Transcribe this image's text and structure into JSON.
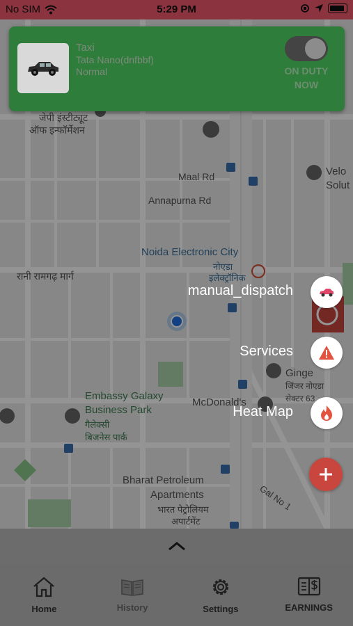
{
  "status_bar": {
    "carrier": "No SIM",
    "time": "5:29 PM"
  },
  "duty_card": {
    "vehicle_type": "Taxi",
    "vehicle_name": "Tata Nano(dnfbbf)",
    "vehicle_class": "Normal",
    "duty_status_line1": "ON DUTY",
    "duty_status_line2": "NOW",
    "toggle_on": true,
    "card_color": "#2f7d3a"
  },
  "map": {
    "labels": [
      {
        "text": "जेपी इंस्टीट्यूट",
        "style": "normal"
      },
      {
        "text": "ऑफ इन्फॉर्मेशन",
        "style": "normal"
      },
      {
        "text": "Maal Rd",
        "style": "normal"
      },
      {
        "text": "Annapurna Rd",
        "style": "normal"
      },
      {
        "text": "Noida Electronic City",
        "style": "blue"
      },
      {
        "text": "नोएडा",
        "style": "blue"
      },
      {
        "text": "इलेक्ट्रॉनिक",
        "style": "blue"
      },
      {
        "text": "रानी रामगढ़ मार्ग",
        "style": "normal"
      },
      {
        "text": "Embassy Galaxy",
        "style": "green"
      },
      {
        "text": "Business Park",
        "style": "green"
      },
      {
        "text": "गैलेक्सी",
        "style": "green"
      },
      {
        "text": "बिजनेस पार्क",
        "style": "green"
      },
      {
        "text": "McDonald's",
        "style": "normal"
      },
      {
        "text": "Bharat Petroleum",
        "style": "normal"
      },
      {
        "text": "Apartments",
        "style": "normal"
      },
      {
        "text": "भारत पेट्रोलियम",
        "style": "normal"
      },
      {
        "text": "अपार्टमेंट",
        "style": "normal"
      },
      {
        "text": "Gal No 1",
        "style": "normal"
      },
      {
        "text": "Velo",
        "style": "normal"
      },
      {
        "text": "Solut",
        "style": "normal"
      },
      {
        "text": "Ginge",
        "style": "normal"
      },
      {
        "text": "जिंजर नोएडा",
        "style": "normal"
      },
      {
        "text": "सेक्टर 63",
        "style": "normal"
      }
    ]
  },
  "fab_menu": {
    "manual_dispatch": "manual_dispatch",
    "services": "Services",
    "heat_map": "Heat Map"
  },
  "tabs": [
    {
      "label": "Home",
      "icon": "home-icon"
    },
    {
      "label": "History",
      "icon": "book-icon"
    },
    {
      "label": "Settings",
      "icon": "gear-icon"
    },
    {
      "label": "EARNINGS",
      "icon": "earnings-icon"
    }
  ],
  "colors": {
    "accent_red": "#c9463e",
    "status_bar": "#f05a6e"
  }
}
